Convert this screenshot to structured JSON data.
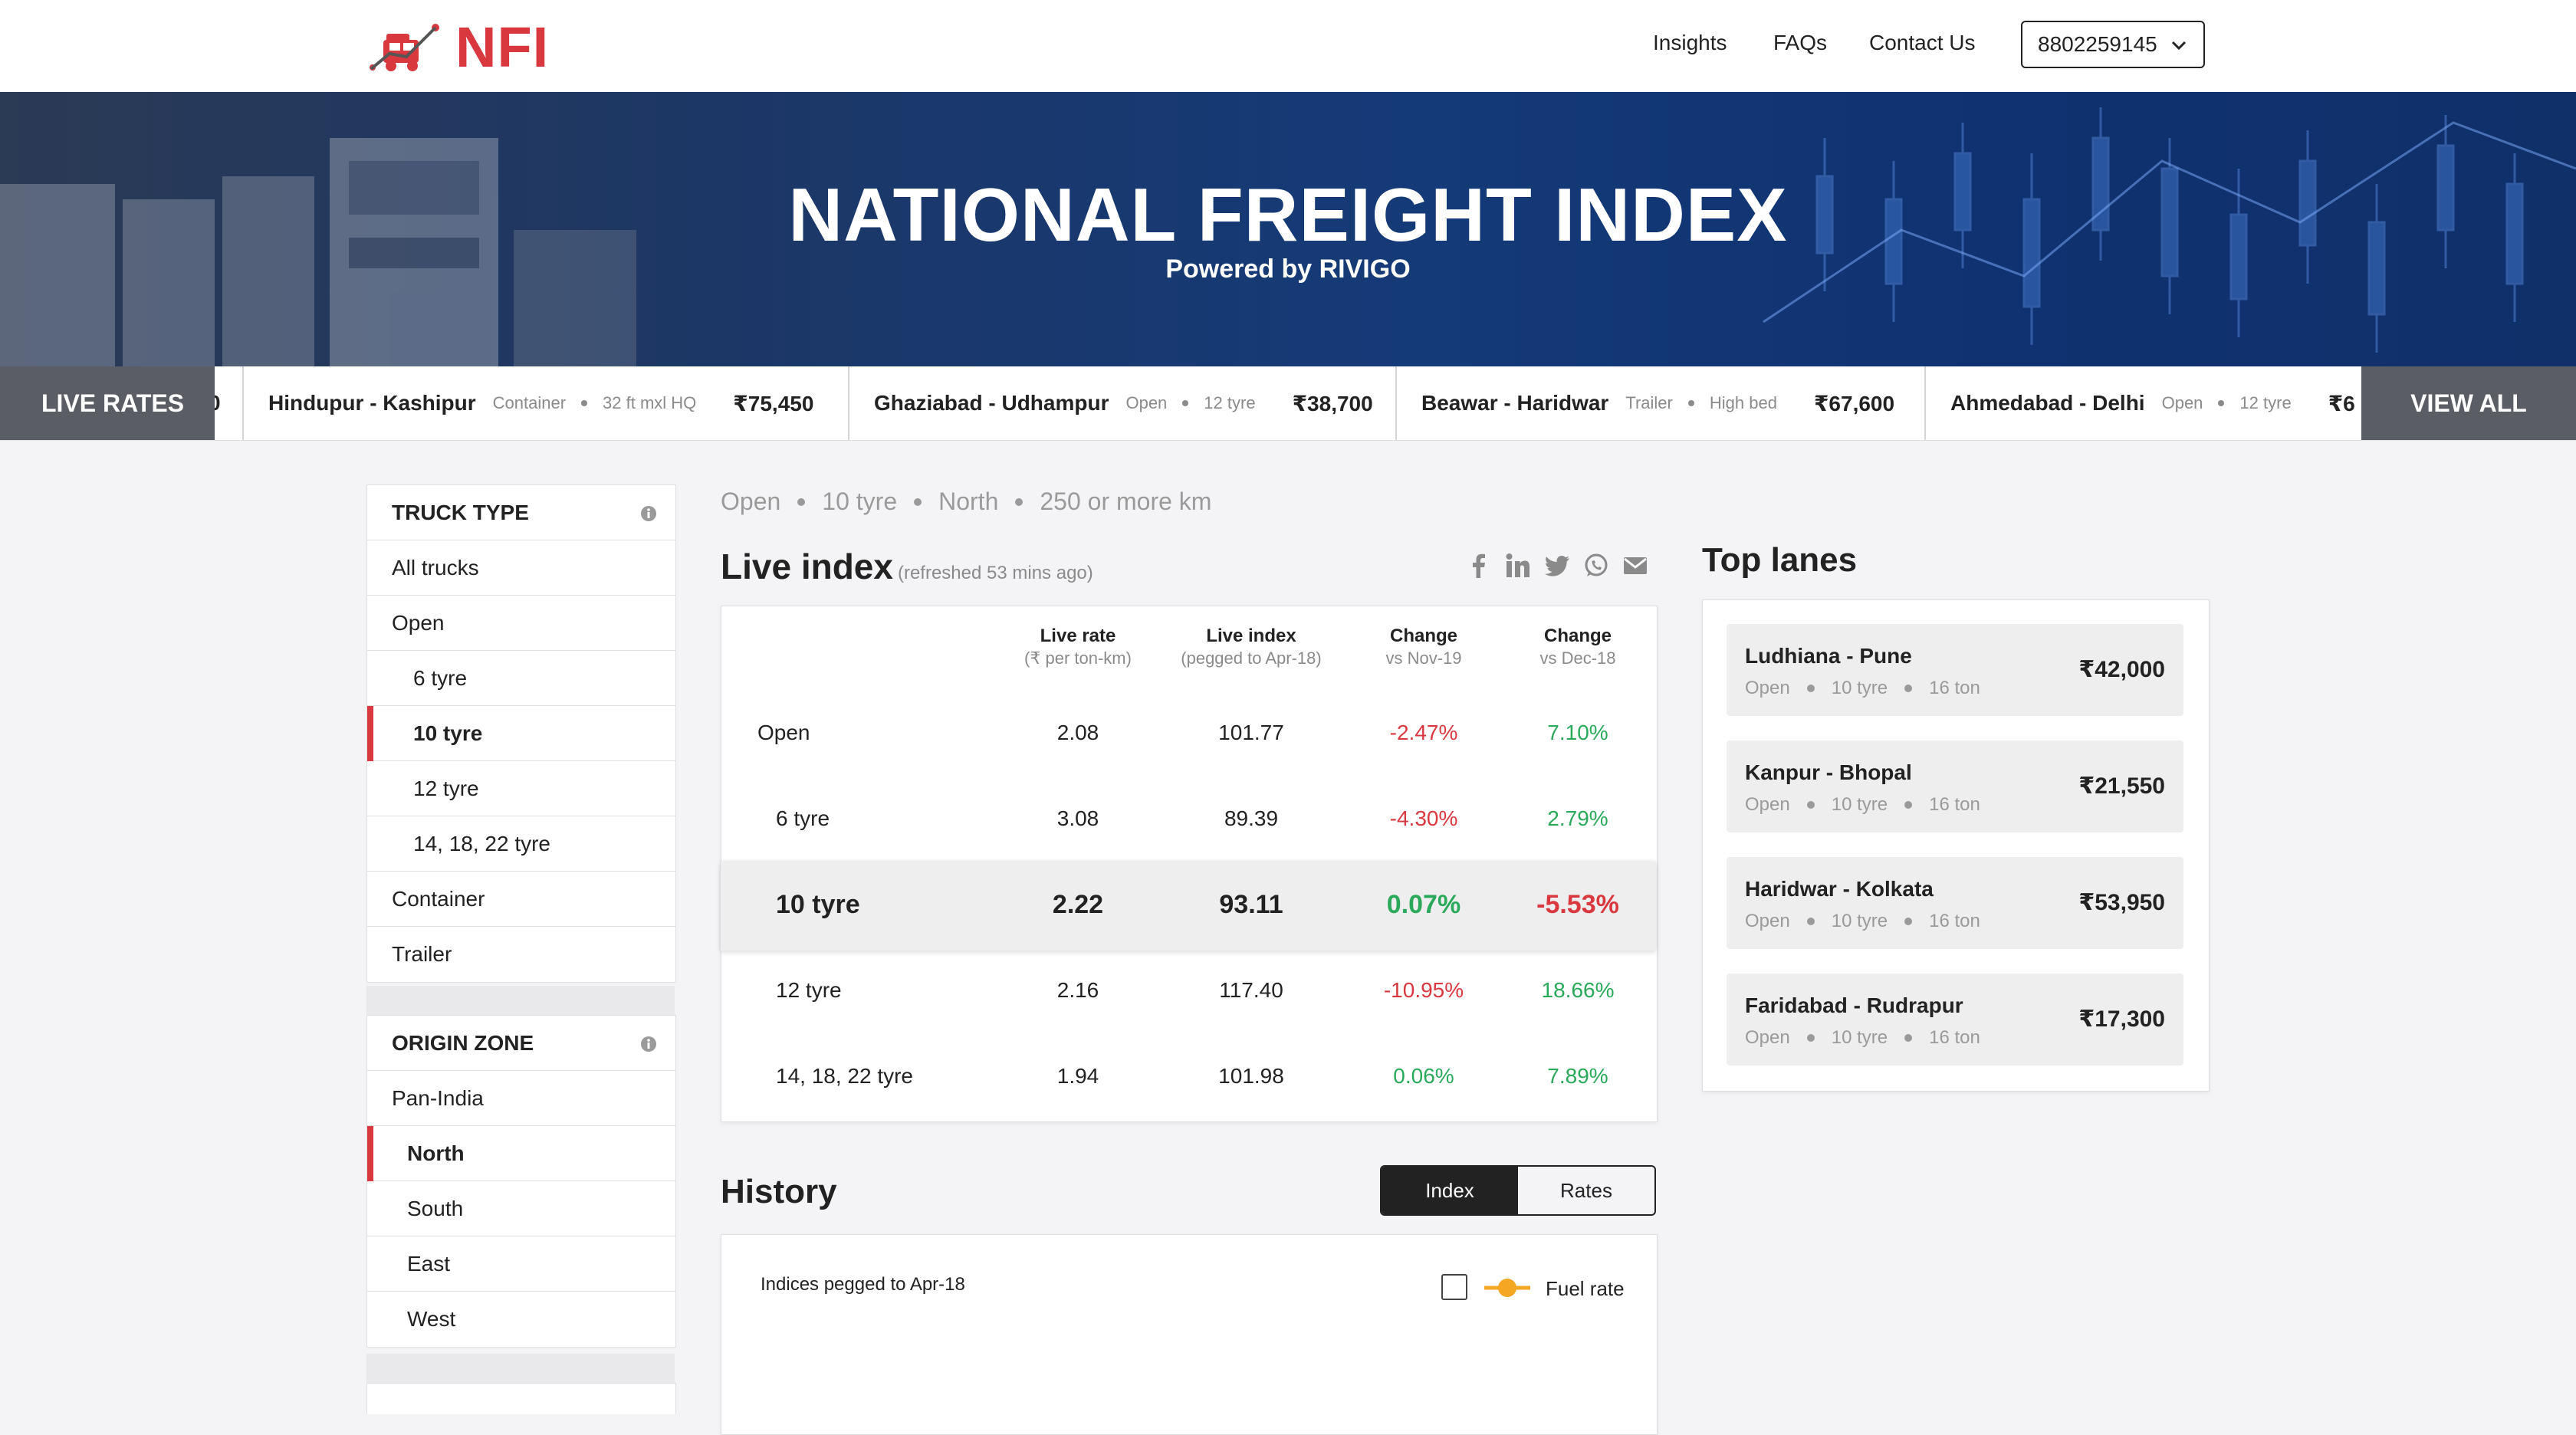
{
  "brand": {
    "name": "NFI"
  },
  "nav": {
    "insights": "Insights",
    "faqs": "FAQs",
    "contact": "Contact Us",
    "phone": "8802259145"
  },
  "hero": {
    "title": "NATIONAL FREIGHT INDEX",
    "subtitle": "Powered by RIVIGO"
  },
  "ticker": {
    "label": "LIVE RATES",
    "view_all": "VIEW ALL",
    "partial_left": "0",
    "items": [
      {
        "lane": "Hindupur - Kashipur",
        "type": "Container",
        "spec": "32 ft mxl HQ",
        "price": "₹75,450"
      },
      {
        "lane": "Ghaziabad - Udhampur",
        "type": "Open",
        "spec": "12 tyre",
        "price": "₹38,700"
      },
      {
        "lane": "Beawar - Haridwar",
        "type": "Trailer",
        "spec": "High bed",
        "price": "₹67,600"
      },
      {
        "lane": "Ahmedabad - Delhi",
        "type": "Open",
        "spec": "12 tyre",
        "price": "₹6"
      }
    ]
  },
  "filters": {
    "truck_type": {
      "title": "TRUCK TYPE",
      "options": [
        "All trucks",
        "Open",
        "6 tyre",
        "10 tyre",
        "12 tyre",
        "14, 18, 22 tyre",
        "Container",
        "Trailer"
      ],
      "selected": "10 tyre"
    },
    "origin_zone": {
      "title": "ORIGIN ZONE",
      "options": [
        "Pan-India",
        "North",
        "South",
        "East",
        "West"
      ],
      "selected": "North"
    }
  },
  "breadcrumb": [
    "Open",
    "10 tyre",
    "North",
    "250 or more km"
  ],
  "live_index": {
    "title": "Live index",
    "refreshed": "(refreshed 53 mins ago)",
    "columns": [
      {
        "label": "Live rate",
        "sub": "(₹ per ton-km)"
      },
      {
        "label": "Live index",
        "sub": "(pegged to Apr-18)"
      },
      {
        "label": "Change",
        "sub": "vs Nov-19"
      },
      {
        "label": "Change",
        "sub": "vs Dec-18"
      }
    ],
    "rows": [
      {
        "name": "Open",
        "rate": "2.08",
        "index": "101.77",
        "chg1": "-2.47%",
        "chg2": "7.10%"
      },
      {
        "name": "6 tyre",
        "rate": "3.08",
        "index": "89.39",
        "chg1": "-4.30%",
        "chg2": "2.79%"
      },
      {
        "name": "10 tyre",
        "rate": "2.22",
        "index": "93.11",
        "chg1": "0.07%",
        "chg2": "-5.53%"
      },
      {
        "name": "12 tyre",
        "rate": "2.16",
        "index": "117.40",
        "chg1": "-10.95%",
        "chg2": "18.66%"
      },
      {
        "name": "14, 18, 22 tyre",
        "rate": "1.94",
        "index": "101.98",
        "chg1": "0.06%",
        "chg2": "7.89%"
      }
    ]
  },
  "share_icons": [
    "facebook-icon",
    "linkedin-icon",
    "twitter-icon",
    "whatsapp-icon",
    "email-icon"
  ],
  "history": {
    "title": "History",
    "toggle": [
      "Index",
      "Rates"
    ],
    "active": "Index",
    "note": "Indices pegged to Apr-18",
    "fuel_label": "Fuel rate"
  },
  "top_lanes": {
    "title": "Top lanes",
    "items": [
      {
        "lane": "Ludhiana - Pune",
        "meta": [
          "Open",
          "10 tyre",
          "16 ton"
        ],
        "price": "₹42,000"
      },
      {
        "lane": "Kanpur - Bhopal",
        "meta": [
          "Open",
          "10 tyre",
          "16 ton"
        ],
        "price": "₹21,550"
      },
      {
        "lane": "Haridwar - Kolkata",
        "meta": [
          "Open",
          "10 tyre",
          "16 ton"
        ],
        "price": "₹53,950"
      },
      {
        "lane": "Faridabad - Rudrapur",
        "meta": [
          "Open",
          "10 tyre",
          "16 ton"
        ],
        "price": "₹17,300"
      }
    ]
  },
  "colors": {
    "brand_red": "#d9383f",
    "positive": "#2aa95a",
    "negative": "#d9383f",
    "accent_orange": "#f5a623"
  }
}
